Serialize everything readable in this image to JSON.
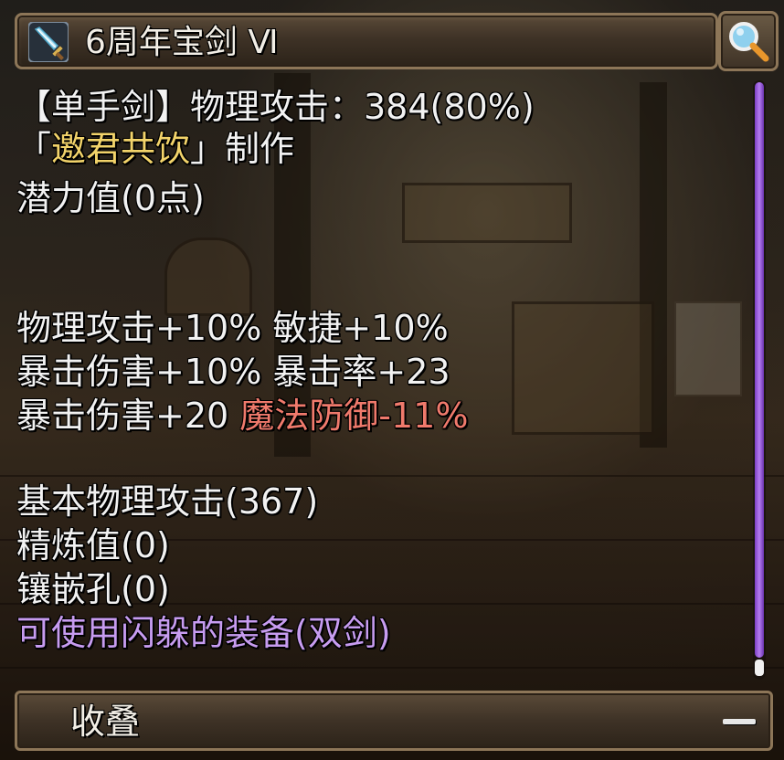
{
  "item": {
    "title": "6周年宝剑 Ⅵ",
    "icon": "sword-icon"
  },
  "search": {
    "icon": "magnifier-icon"
  },
  "stats": {
    "line1": "【单手剑】物理攻击：384(80%)",
    "maker_open": "「",
    "maker_name": "邀君共饮",
    "maker_close": "」制作",
    "potential": "潜力值(0点)",
    "attr_row1": "物理攻击+10% 敏捷+10%",
    "attr_row2": "暴击伤害+10% 暴击率+23",
    "attr_row3_white": "暴击伤害+20 ",
    "attr_row3_red": "魔法防御-11%",
    "base_attack": "基本物理攻击(367)",
    "refine": "精炼值(0)",
    "socket": "镶嵌孔(0)",
    "dodge_note": "可使用闪躲的装备(双剑)"
  },
  "footer": {
    "collapse_label": "收叠",
    "collapse_icon": "minus-icon"
  },
  "colors": {
    "maker_name": "#f2d36a",
    "negative_stat": "#f07a6c",
    "special_note": "#c79cf0",
    "scroll_thumb": "#b57cf0"
  }
}
